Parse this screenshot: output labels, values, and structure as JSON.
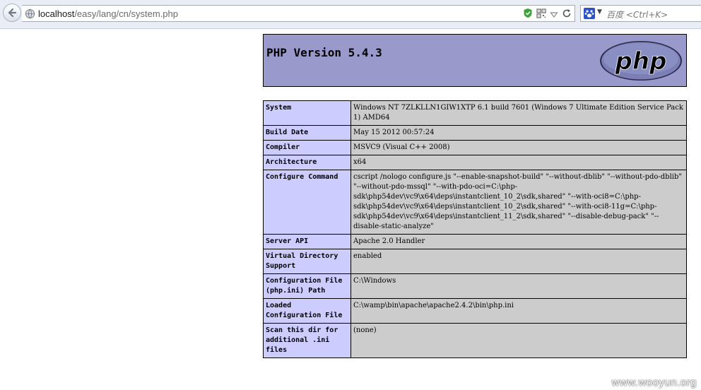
{
  "browser": {
    "url_host": "localhost",
    "url_path": "/easy/lang/cn/system.php",
    "search_placeholder": "百度 <Ctrl+K>"
  },
  "header": {
    "title": "PHP Version 5.4.3",
    "logo_text": "php"
  },
  "rows": [
    {
      "label": "System",
      "value": "Windows NT 7ZLKLLN1GIW1XTP 6.1 build 7601 (Windows 7 Ultimate Edition Service Pack 1) AMD64"
    },
    {
      "label": "Build Date",
      "value": "May 15 2012 00:57:24"
    },
    {
      "label": "Compiler",
      "value": "MSVC9 (Visual C++ 2008)"
    },
    {
      "label": "Architecture",
      "value": "x64"
    },
    {
      "label": "Configure Command",
      "value": "cscript /nologo configure.js \"--enable-snapshot-build\" \"--without-dblib\" \"--without-pdo-dblib\" \"--without-pdo-mssql\" \"--with-pdo-oci=C:\\php-sdk\\php54dev\\vc9\\x64\\deps\\instantclient_10_2\\sdk,shared\" \"--with-oci8=C:\\php-sdk\\php54dev\\vc9\\x64\\deps\\instantclient_10_2\\sdk,shared\" \"--with-oci8-11g=C:\\php-sdk\\php54dev\\vc9\\x64\\deps\\instantclient_11_2\\sdk,shared\" \"--disable-debug-pack\" \"--disable-static-analyze\""
    },
    {
      "label": "Server API",
      "value": "Apache 2.0 Handler"
    },
    {
      "label": "Virtual Directory Support",
      "value": "enabled"
    },
    {
      "label": "Configuration File (php.ini) Path",
      "value": "C:\\Windows"
    },
    {
      "label": "Loaded Configuration File",
      "value": "C:\\wamp\\bin\\apache\\apache2.4.2\\bin\\php.ini"
    },
    {
      "label": "Scan this dir for additional .ini files",
      "value": "(none)"
    }
  ],
  "watermark": "www.wooyun.org"
}
